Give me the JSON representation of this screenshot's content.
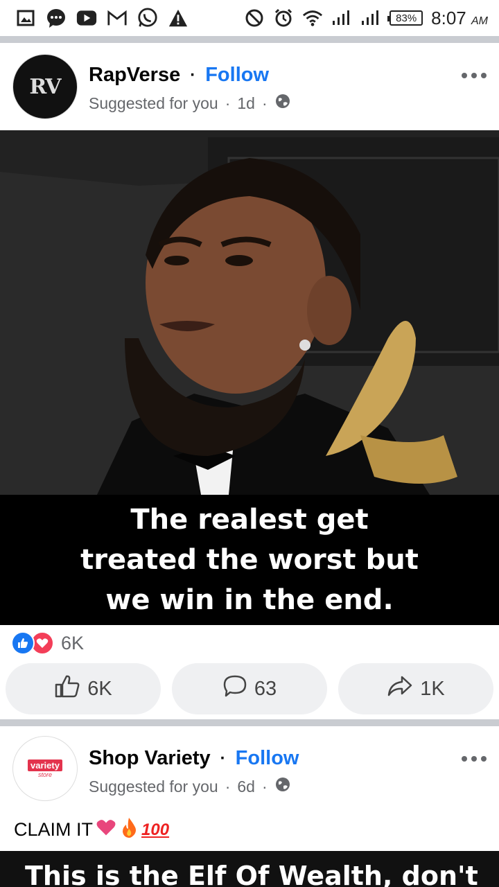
{
  "status_bar": {
    "battery": "83%",
    "time": "8:07",
    "time_suffix": "AM"
  },
  "posts": [
    {
      "avatar_text": "RV",
      "page_name": "RapVerse",
      "separator": "·",
      "follow_label": "Follow",
      "suggested": "Suggested for you",
      "age": "1d",
      "caption_image_text": "The realest get treated the worst but we win in the end.",
      "reaction_count": "6K",
      "actions": {
        "like": "6K",
        "comment": "63",
        "share": "1K"
      }
    },
    {
      "avatar_text": "variety",
      "avatar_subtext": "store",
      "page_name": "Shop Variety",
      "separator": "·",
      "follow_label": "Follow",
      "suggested": "Suggested for you",
      "age": "6d",
      "body_text": "CLAIM IT",
      "body_emoji_text": "100",
      "image_text": "This is the Elf Of Wealth, don't"
    }
  ],
  "colors": {
    "accent": "#1877f2",
    "love": "#f33e58",
    "divider": "#c9ccd1"
  },
  "icons": [
    "gallery-icon",
    "messenger-icon",
    "youtube-icon",
    "gmail-icon",
    "whatsapp-icon",
    "warning-icon",
    "dnd-icon",
    "alarm-icon",
    "wifi-icon",
    "signal-icon",
    "globe-icon",
    "more-icon",
    "like-icon",
    "comment-icon",
    "share-icon",
    "heart-icon",
    "fire-icon"
  ]
}
